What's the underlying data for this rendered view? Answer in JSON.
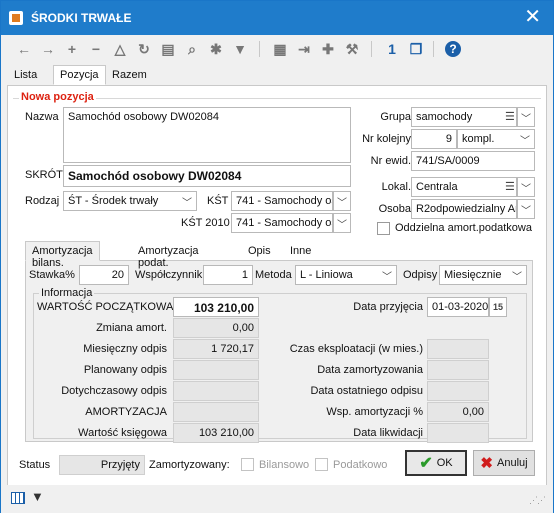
{
  "window": {
    "title": "ŚRODKI TRWAŁE",
    "close_label": "✕"
  },
  "toolbar": {
    "icons": [
      "arrow-left-icon",
      "arrow-right-icon",
      "plus-icon",
      "minus-icon",
      "delta-icon",
      "refresh-icon",
      "print-icon",
      "search-icon",
      "settings-icon",
      "filter-icon",
      "document-icon",
      "export-icon",
      "puzzle-icon",
      "tools-icon",
      "calendar-icon",
      "copy-icon",
      "help-icon"
    ],
    "glyphs": {
      "left": "←",
      "right": "→",
      "plus": "+",
      "minus": "−",
      "delta": "△",
      "refresh": "↻",
      "print": "▤",
      "search": "⌕",
      "settings": "✱",
      "filter": "▼",
      "document": "▦",
      "export": "⇥",
      "puzzle": "✚",
      "tools": "⚒",
      "calendar": "1",
      "copy": "❐",
      "help": "?"
    }
  },
  "tabs_top": [
    "Lista",
    "Pozycja",
    "Razem"
  ],
  "form": {
    "section_title": "Nowa pozycja",
    "nazwa_label": "Nazwa",
    "nazwa_value": "Samochód osobowy DW02084",
    "skrot_label": "SKRÓT",
    "skrot_value": "Samochód osobowy DW02084",
    "rodzaj_label": "Rodzaj",
    "rodzaj_value": "ŚT - Środek trwały",
    "kst_label": "KŚT",
    "kst_value": "741 - Samochody oso",
    "kst2010_label": "KŚT 2010",
    "kst2010_value": "741 - Samochody oso",
    "grupa_label": "Grupa",
    "grupa_value": "samochody",
    "nr_kolejny_label": "Nr kolejny",
    "nr_kolejny_value": "9",
    "kompl_value": "kompl.",
    "nr_ewid_label": "Nr ewid.",
    "nr_ewid_value": "741/SA/0009",
    "lokal_label": "Lokal.",
    "lokal_value": "Centrala",
    "osoba_label": "Osoba",
    "osoba_value": "R2odpowiedzialny Ar",
    "oddzielna_label": "Oddzielna amort.podatkowa"
  },
  "subtabs": [
    "Amortyzacja bilans.",
    "Amortyzacja podat.",
    "Opis",
    "Inne"
  ],
  "amort": {
    "stawka_label": "Stawka%",
    "stawka_value": "20",
    "wspolczynnik_label": "Współczynnik",
    "wspolczynnik_value": "1",
    "metoda_label": "Metoda",
    "metoda_value": "L - Liniowa",
    "odpisy_label": "Odpisy",
    "odpisy_value": "Miesięcznie",
    "info_legend": "Informacja",
    "wartosc_pocz_label": "WARTOŚĆ POCZĄTKOWA",
    "wartosc_pocz_value": "103 210,00",
    "zmiana_label": "Zmiana amort.",
    "zmiana_value": "0,00",
    "miesieczny_label": "Miesięczny odpis",
    "miesieczny_value": "1 720,17",
    "planowany_label": "Planowany odpis",
    "planowany_value": "",
    "dotychczasowy_label": "Dotychczasowy odpis",
    "dotychczasowy_value": "",
    "amortyzacja_label": "AMORTYZACJA",
    "amortyzacja_value": "",
    "ksiegowa_label": "Wartość księgowa",
    "ksiegowa_value": "103 210,00",
    "data_przyjecia_label": "Data przyjęcia",
    "data_przyjecia_value": "01-03-2020",
    "czas_label": "Czas eksploatacji (w mies.)",
    "czas_value": "",
    "data_zamortyzowania_label": "Data zamortyzowania",
    "data_zamortyzowania_value": "",
    "data_ostatniego_label": "Data ostatniego odpisu",
    "data_ostatniego_value": "",
    "wsp_label": "Wsp. amortyzacji %",
    "wsp_value": "0,00",
    "data_likwidacji_label": "Data likwidacji",
    "data_likwidacji_value": ""
  },
  "footer": {
    "status_label": "Status",
    "status_value": "Przyjęty",
    "zamortyzowany_label": "Zamortyzowany:",
    "bilansowo_label": "Bilansowo",
    "podatkowo_label": "Podatkowo",
    "ok_label": "OK",
    "anuluj_label": "Anuluj"
  },
  "colors": {
    "titlebar": "#1f7ccb",
    "section_title": "#dd2211",
    "ok_check": "#2a9a2a",
    "cancel_x": "#d01c1c"
  }
}
